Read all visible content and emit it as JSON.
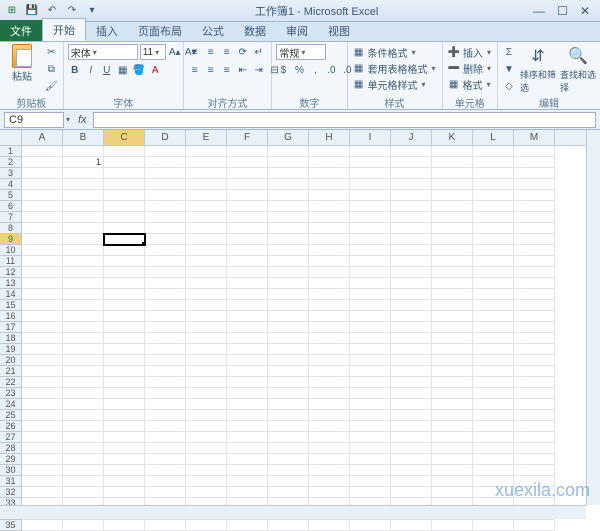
{
  "title": "工作簿1 - Microsoft Excel",
  "qat": {
    "save": "💾",
    "undo": "↶",
    "redo": "↷"
  },
  "win": {
    "min": "―",
    "max": "☐",
    "close": "✕"
  },
  "tabs": {
    "file": "文件",
    "items": [
      "开始",
      "插入",
      "页面布局",
      "公式",
      "数据",
      "审阅",
      "视图"
    ],
    "active": 0
  },
  "ribbon": {
    "clipboard": {
      "paste": "粘贴",
      "label": "剪贴板"
    },
    "font": {
      "name": "宋体",
      "size": "11",
      "bold": "B",
      "italic": "I",
      "underline": "U",
      "label": "字体"
    },
    "align": {
      "label": "对齐方式"
    },
    "number": {
      "combo": "常规",
      "label": "数字"
    },
    "styles": {
      "cond": "条件格式",
      "tbl": "套用表格格式",
      "cell": "单元格样式",
      "label": "样式"
    },
    "cells": {
      "insert": "插入",
      "delete": "删除",
      "format": "格式",
      "label": "单元格"
    },
    "editing": {
      "sort": "排序和筛选",
      "find": "查找和选择",
      "label": "编辑"
    }
  },
  "namebox": "C9",
  "fx": "fx",
  "columns": [
    "A",
    "B",
    "C",
    "D",
    "E",
    "F",
    "G",
    "H",
    "I",
    "J",
    "K",
    "L",
    "M"
  ],
  "rows_count": 35,
  "selected": {
    "row": 9,
    "col": "C"
  },
  "cells": {
    "B2": "1"
  },
  "watermark": "xuexila.com"
}
